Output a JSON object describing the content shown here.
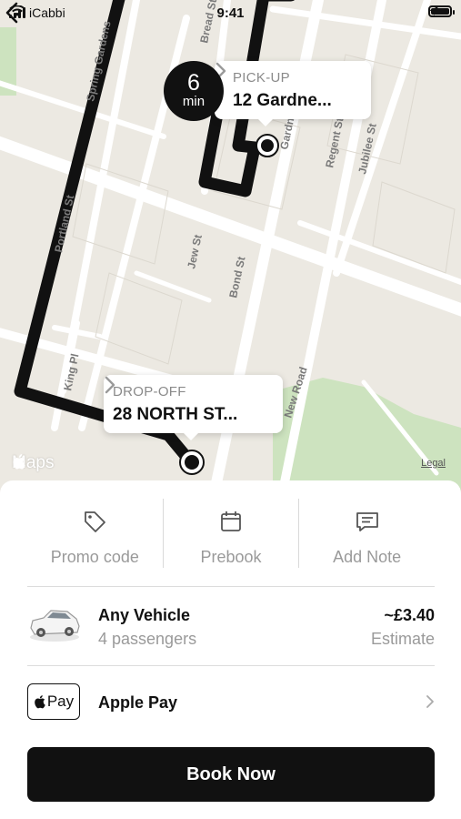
{
  "status_bar": {
    "carrier": "iCabbi",
    "time": "9:41"
  },
  "map": {
    "streets": [
      "Spring Gardens",
      "Bread St",
      "Portland St",
      "Jew St",
      "Bond St",
      "Regent St",
      "Jubilee St",
      "King Pl",
      "New Road",
      "Gardner St"
    ],
    "eta": {
      "value": "6",
      "unit": "min"
    },
    "pickup": {
      "caption": "PICK-UP",
      "address": "12 Gardne..."
    },
    "dropoff": {
      "caption": "DROP-OFF",
      "address": "28 NORTH ST..."
    },
    "attribution": "Maps",
    "legal": "Legal",
    "colors": {
      "route": "#111111",
      "park": "#cde3bf",
      "land": "#ece9e2",
      "roads": "#ffffff"
    }
  },
  "actions": [
    {
      "label": "Promo code",
      "icon": "tag-icon"
    },
    {
      "label": "Prebook",
      "icon": "calendar-icon"
    },
    {
      "label": "Add Note",
      "icon": "note-icon"
    }
  ],
  "vehicle": {
    "name": "Any Vehicle",
    "passengers": "4 passengers",
    "price": "~£3.40",
    "price_caption": "Estimate",
    "icon": "car-icon"
  },
  "payment": {
    "badge": "Pay",
    "label": "Apple Pay",
    "icon": "apple-icon"
  },
  "book_button": "Book Now"
}
